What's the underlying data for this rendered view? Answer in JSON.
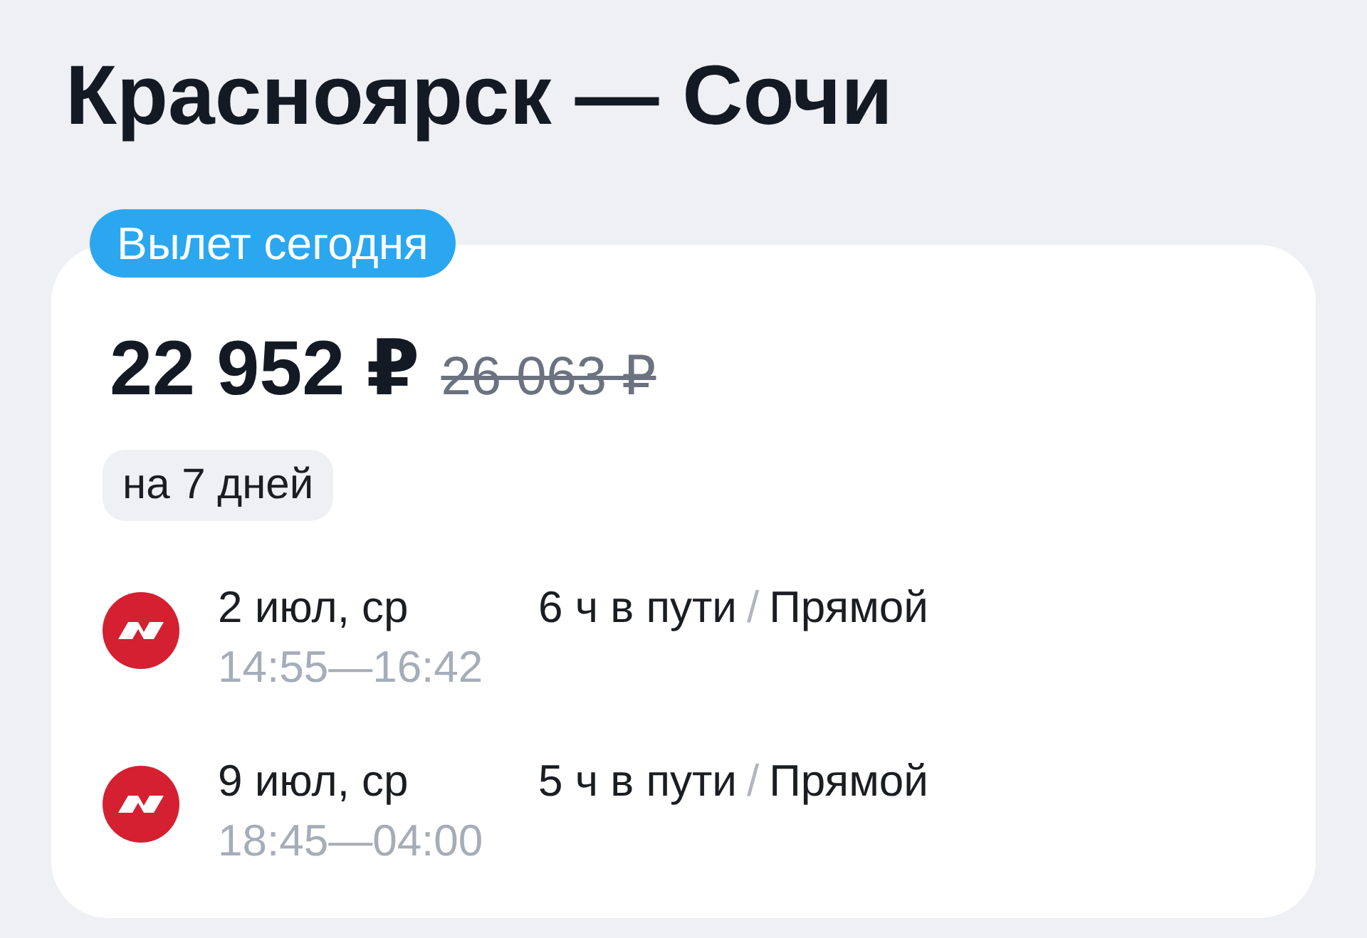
{
  "title": "Красноярск — Сочи",
  "offer": {
    "badge": "Вылет сегодня",
    "price": "22 952 ₽",
    "old_price": "26 063 ₽",
    "trip_length": "на 7 дней",
    "segments": [
      {
        "date": "2 июл, ср",
        "times": "14:55—16:42",
        "duration": "6 ч в пути",
        "separator": "/",
        "stops": "Прямой"
      },
      {
        "date": "9 июл, ср",
        "times": "18:45—04:00",
        "duration": "5 ч в пути",
        "separator": "/",
        "stops": "Прямой"
      }
    ]
  }
}
